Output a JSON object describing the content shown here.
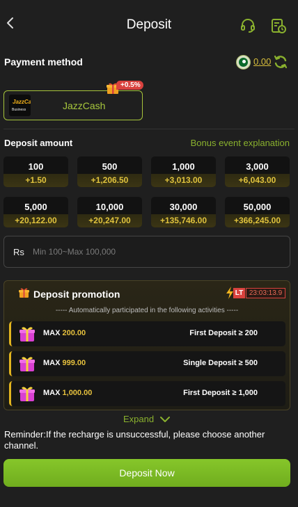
{
  "header": {
    "title": "Deposit"
  },
  "payment": {
    "label": "Payment method",
    "balance": "0.00",
    "methods": [
      {
        "name": "JazzCash",
        "logo_top": "JazzCash",
        "logo_bottom": "Business",
        "bonus": "+0.5%"
      }
    ]
  },
  "amount": {
    "label": "Deposit amount",
    "bonus_link": "Bonus event explanation",
    "options": [
      {
        "value": "100",
        "bonus": "+1.50"
      },
      {
        "value": "500",
        "bonus": "+1,206.50"
      },
      {
        "value": "1,000",
        "bonus": "+3,013.00"
      },
      {
        "value": "3,000",
        "bonus": "+6,043.00"
      },
      {
        "value": "5,000",
        "bonus": "+20,122.00"
      },
      {
        "value": "10,000",
        "bonus": "+20,247.00"
      },
      {
        "value": "30,000",
        "bonus": "+135,746.00"
      },
      {
        "value": "50,000",
        "bonus": "+366,245.00"
      }
    ],
    "currency": "Rs",
    "placeholder": "Min 100~Max 100,000"
  },
  "promotion": {
    "title": "Deposit promotion",
    "lt_label": "LT",
    "timer": "23:03:13.9",
    "subtitle": "----- Automatically participated in the following activities -----",
    "rows": [
      {
        "max_label": "MAX",
        "max_value": "200.00",
        "condition": "First Deposit ≥ 200"
      },
      {
        "max_label": "MAX",
        "max_value": "999.00",
        "condition": "Single Deposit ≥ 500"
      },
      {
        "max_label": "MAX",
        "max_value": "1,000.00",
        "condition": "First Deposit ≥ 1,000"
      }
    ],
    "expand_label": "Expand"
  },
  "reminder": "Reminder:If the recharge is unsuccessful, please choose another channel.",
  "deposit_button": "Deposit Now",
  "icons": {
    "back": "chevron-left-icon",
    "support": "headset-icon",
    "records": "records-clock-icon",
    "flag": "pakistan-flag-icon",
    "refresh": "refresh-icon",
    "gift": "gift-icon",
    "bolt": "lightning-icon",
    "expand": "chevron-down-icon"
  },
  "colors": {
    "accent_green": "#8ab12e",
    "button_green": "#7ab924",
    "gold": "#e0c33d",
    "badge_red": "#d9423e",
    "background": "#1f1f1f"
  }
}
